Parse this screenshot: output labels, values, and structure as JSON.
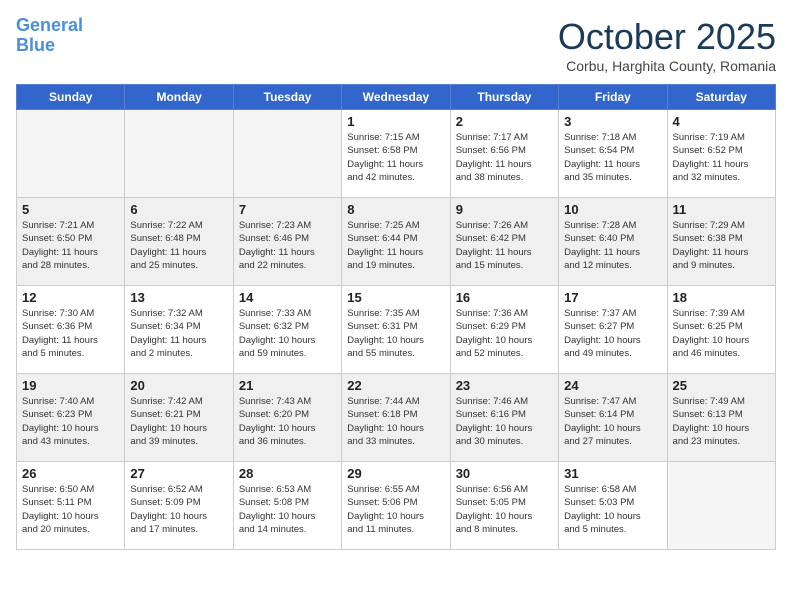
{
  "header": {
    "logo_line1": "General",
    "logo_line2": "Blue",
    "month": "October 2025",
    "location": "Corbu, Harghita County, Romania"
  },
  "days_of_week": [
    "Sunday",
    "Monday",
    "Tuesday",
    "Wednesday",
    "Thursday",
    "Friday",
    "Saturday"
  ],
  "weeks": [
    [
      {
        "day": "",
        "info": ""
      },
      {
        "day": "",
        "info": ""
      },
      {
        "day": "",
        "info": ""
      },
      {
        "day": "1",
        "info": "Sunrise: 7:15 AM\nSunset: 6:58 PM\nDaylight: 11 hours\nand 42 minutes."
      },
      {
        "day": "2",
        "info": "Sunrise: 7:17 AM\nSunset: 6:56 PM\nDaylight: 11 hours\nand 38 minutes."
      },
      {
        "day": "3",
        "info": "Sunrise: 7:18 AM\nSunset: 6:54 PM\nDaylight: 11 hours\nand 35 minutes."
      },
      {
        "day": "4",
        "info": "Sunrise: 7:19 AM\nSunset: 6:52 PM\nDaylight: 11 hours\nand 32 minutes."
      }
    ],
    [
      {
        "day": "5",
        "info": "Sunrise: 7:21 AM\nSunset: 6:50 PM\nDaylight: 11 hours\nand 28 minutes."
      },
      {
        "day": "6",
        "info": "Sunrise: 7:22 AM\nSunset: 6:48 PM\nDaylight: 11 hours\nand 25 minutes."
      },
      {
        "day": "7",
        "info": "Sunrise: 7:23 AM\nSunset: 6:46 PM\nDaylight: 11 hours\nand 22 minutes."
      },
      {
        "day": "8",
        "info": "Sunrise: 7:25 AM\nSunset: 6:44 PM\nDaylight: 11 hours\nand 19 minutes."
      },
      {
        "day": "9",
        "info": "Sunrise: 7:26 AM\nSunset: 6:42 PM\nDaylight: 11 hours\nand 15 minutes."
      },
      {
        "day": "10",
        "info": "Sunrise: 7:28 AM\nSunset: 6:40 PM\nDaylight: 11 hours\nand 12 minutes."
      },
      {
        "day": "11",
        "info": "Sunrise: 7:29 AM\nSunset: 6:38 PM\nDaylight: 11 hours\nand 9 minutes."
      }
    ],
    [
      {
        "day": "12",
        "info": "Sunrise: 7:30 AM\nSunset: 6:36 PM\nDaylight: 11 hours\nand 5 minutes."
      },
      {
        "day": "13",
        "info": "Sunrise: 7:32 AM\nSunset: 6:34 PM\nDaylight: 11 hours\nand 2 minutes."
      },
      {
        "day": "14",
        "info": "Sunrise: 7:33 AM\nSunset: 6:32 PM\nDaylight: 10 hours\nand 59 minutes."
      },
      {
        "day": "15",
        "info": "Sunrise: 7:35 AM\nSunset: 6:31 PM\nDaylight: 10 hours\nand 55 minutes."
      },
      {
        "day": "16",
        "info": "Sunrise: 7:36 AM\nSunset: 6:29 PM\nDaylight: 10 hours\nand 52 minutes."
      },
      {
        "day": "17",
        "info": "Sunrise: 7:37 AM\nSunset: 6:27 PM\nDaylight: 10 hours\nand 49 minutes."
      },
      {
        "day": "18",
        "info": "Sunrise: 7:39 AM\nSunset: 6:25 PM\nDaylight: 10 hours\nand 46 minutes."
      }
    ],
    [
      {
        "day": "19",
        "info": "Sunrise: 7:40 AM\nSunset: 6:23 PM\nDaylight: 10 hours\nand 43 minutes."
      },
      {
        "day": "20",
        "info": "Sunrise: 7:42 AM\nSunset: 6:21 PM\nDaylight: 10 hours\nand 39 minutes."
      },
      {
        "day": "21",
        "info": "Sunrise: 7:43 AM\nSunset: 6:20 PM\nDaylight: 10 hours\nand 36 minutes."
      },
      {
        "day": "22",
        "info": "Sunrise: 7:44 AM\nSunset: 6:18 PM\nDaylight: 10 hours\nand 33 minutes."
      },
      {
        "day": "23",
        "info": "Sunrise: 7:46 AM\nSunset: 6:16 PM\nDaylight: 10 hours\nand 30 minutes."
      },
      {
        "day": "24",
        "info": "Sunrise: 7:47 AM\nSunset: 6:14 PM\nDaylight: 10 hours\nand 27 minutes."
      },
      {
        "day": "25",
        "info": "Sunrise: 7:49 AM\nSunset: 6:13 PM\nDaylight: 10 hours\nand 23 minutes."
      }
    ],
    [
      {
        "day": "26",
        "info": "Sunrise: 6:50 AM\nSunset: 5:11 PM\nDaylight: 10 hours\nand 20 minutes."
      },
      {
        "day": "27",
        "info": "Sunrise: 6:52 AM\nSunset: 5:09 PM\nDaylight: 10 hours\nand 17 minutes."
      },
      {
        "day": "28",
        "info": "Sunrise: 6:53 AM\nSunset: 5:08 PM\nDaylight: 10 hours\nand 14 minutes."
      },
      {
        "day": "29",
        "info": "Sunrise: 6:55 AM\nSunset: 5:06 PM\nDaylight: 10 hours\nand 11 minutes."
      },
      {
        "day": "30",
        "info": "Sunrise: 6:56 AM\nSunset: 5:05 PM\nDaylight: 10 hours\nand 8 minutes."
      },
      {
        "day": "31",
        "info": "Sunrise: 6:58 AM\nSunset: 5:03 PM\nDaylight: 10 hours\nand 5 minutes."
      },
      {
        "day": "",
        "info": ""
      }
    ]
  ]
}
